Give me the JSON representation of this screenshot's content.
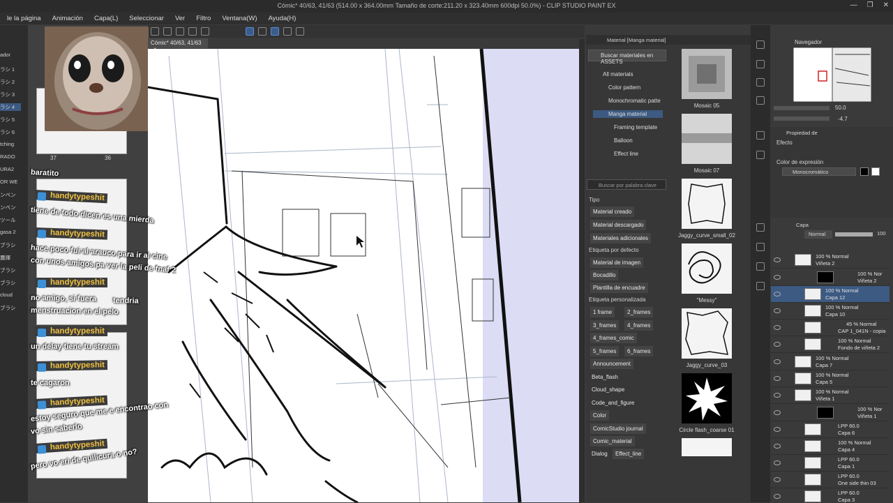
{
  "app": {
    "title": "Cómic* 40/63, 41/63 (514.00 x 364.00mm Tamaño de corte:211.20 x 323.40mm 600dpi 50.0%) - CLIP STUDIO PAINT EX",
    "window_buttons": [
      "—",
      "❐",
      "✕"
    ]
  },
  "menu": [
    "le la página",
    "Animación",
    "Capa(L)",
    "Seleccionar",
    "Ver",
    "Filtro",
    "Ventana(W)",
    "Ayuda(H)"
  ],
  "canvas": {
    "tab_label": "Cómic* 40/63, 41/63",
    "tab_close": "×"
  },
  "left_tools": [
    "ador",
    "ラシ 1",
    "ラシ 2",
    "ラシ 3",
    "ラシ 4",
    "ラシ 5",
    "ラシ 6",
    "tching",
    "RADO",
    "URA2",
    "OR WE",
    "ンペン",
    "ンペン",
    "ツール",
    "gasa 2",
    "ブラシ",
    "贋揮",
    "ブラシ",
    "ブラシ",
    "cloud",
    "ブラシ"
  ],
  "page_numbers": [
    "37",
    "36"
  ],
  "chat": {
    "messages": [
      {
        "text": "baratito"
      },
      {
        "user": "handytypeshit",
        "lines": [
          "tiene de todo dicen es una mierda"
        ]
      },
      {
        "user": "handytypeshit",
        "lines": [
          "hace poco fui al arauco para ir al cine",
          "con unos amigos pa ver la peli de fnaf 2"
        ]
      },
      {
        "user": "handytypeshit",
        "lines": [
          "no amigo, si fuera",
          "tendria",
          "menstruacion en el pelo"
        ]
      },
      {
        "user": "handytypeshit",
        "lines": [
          "un delay tiene tu stream"
        ]
      },
      {
        "user": "handytypeshit",
        "lines": [
          "te cagaron"
        ]
      },
      {
        "user": "handytypeshit",
        "lines": [
          "estoy seguro que me e encontrao con",
          "vo sin saberlo"
        ]
      },
      {
        "user": "handytypeshit",
        "lines": [
          "pero vo eri de quilicura o no?"
        ]
      }
    ]
  },
  "material": {
    "header": "Material [Manga material]",
    "assets_button": "Buscar materiales en ASSETS",
    "tree": [
      "All materials",
      "Color pattern",
      "Monochromatic patte",
      "Manga material",
      "Framing template",
      "Balloon",
      "Effect line"
    ],
    "search_placeholder": "Buscar por palabra clave",
    "section_type": "Tipo",
    "type_tags": [
      "Material creado",
      "Material descargado",
      "Materiales adicionales"
    ],
    "section_default": "Etiqueta por defecto",
    "default_tags": [
      "Material de imagen",
      "Bocadillo",
      "Plantilla de encuadre"
    ],
    "section_custom": "Etiqueta personalizada",
    "custom_tags": [
      [
        "1 frame",
        "2_frames"
      ],
      [
        "3_frames",
        "4_frames"
      ],
      [
        "4_frames_comic"
      ],
      [
        "5_frames",
        "6_frames"
      ],
      [
        "Announcement"
      ],
      [
        "Beta_flash"
      ],
      [
        "Cloud_shape"
      ],
      [
        "Code_and_figure"
      ],
      [
        "Color"
      ],
      [
        "ComicStudio journal"
      ],
      [
        "Comic_material"
      ],
      [
        "Dialog",
        "Effect_line"
      ]
    ],
    "items": [
      "Mosaic 05",
      "Mosaic 07",
      "Jaggy_curve_small_02",
      "\"Messy\"",
      "Jaggy_curve_03",
      "Circle flash_coarse 01"
    ]
  },
  "navigator": {
    "title": "Navegador",
    "zoom": "50.0",
    "rotation": "-4.7"
  },
  "properties": {
    "title": "Propiedad de",
    "effect_label": "Efecto",
    "expression_label": "Color de expresión",
    "expression_value": "Monocromático"
  },
  "layers": {
    "title": "Capa",
    "blend_mode": "Normal",
    "opacity": "100",
    "rows": [
      {
        "l1": "100 % Normal",
        "l2": "Viñeta 2"
      },
      {
        "l1": "100 % Nor",
        "l2": "Viñeta 2"
      },
      {
        "l1": "100 % Normal",
        "l2": "Capa 12"
      },
      {
        "l1": "100 % Normal",
        "l2": "Capa 10"
      },
      {
        "l1": "45 % Normal",
        "l2": "CAP 1_041N - copia"
      },
      {
        "l1": "100 % Normal",
        "l2": "Fondo de viñeta 2"
      },
      {
        "l1": "100 % Normal",
        "l2": "Capa 7"
      },
      {
        "l1": "100 % Normal",
        "l2": "Capa 5"
      },
      {
        "l1": "100 % Normal",
        "l2": "Viñeta 1"
      },
      {
        "l1": "100 % Nor",
        "l2": "Viñeta 1"
      },
      {
        "l1": "LPP 60.0",
        "l2": "Capa 6"
      },
      {
        "l1": "100 % Normal",
        "l2": "Capa 4"
      },
      {
        "l1": "LPP 60.0",
        "l2": "Capa 1"
      },
      {
        "l1": "LPP 60.0",
        "l2": "One side thin 03"
      },
      {
        "l1": "LPP 60.0",
        "l2": "Capa 3"
      }
    ]
  }
}
